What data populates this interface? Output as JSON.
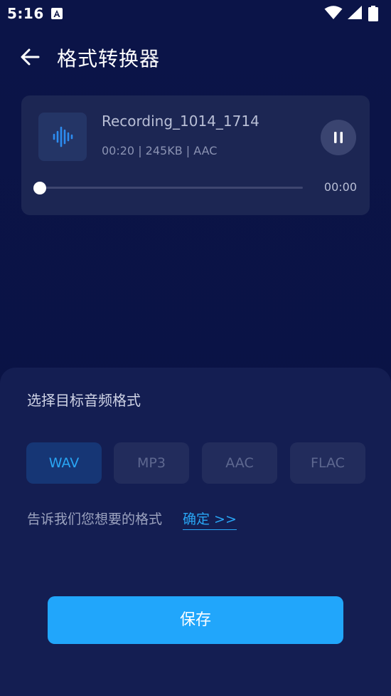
{
  "status_bar": {
    "time": "5:16",
    "notification_icon": "a-letter-icon",
    "icons": [
      "wifi-icon",
      "signal-icon",
      "battery-icon"
    ]
  },
  "header": {
    "title": "格式转换器",
    "back_icon": "arrow-left-icon"
  },
  "recording": {
    "name": "Recording_1014_1714",
    "meta": "00:20 | 245KB | AAC",
    "current_time": "00:00",
    "progress": 0,
    "thumb_icon": "waveform-icon",
    "control_icon": "pause-icon"
  },
  "converter": {
    "title": "选择目标音频格式",
    "formats": [
      "WAV",
      "MP3",
      "AAC",
      "FLAC"
    ],
    "selected": "WAV",
    "hint": "告诉我们您想要的格式",
    "hint_link": "确定 >>",
    "save_label": "保存"
  },
  "colors": {
    "background": "#0a1245",
    "card": "#1c2653",
    "sheet": "#141e52",
    "accent": "#21a6fb",
    "selected_bg": "#163675",
    "selected_text": "#29a6f5"
  }
}
